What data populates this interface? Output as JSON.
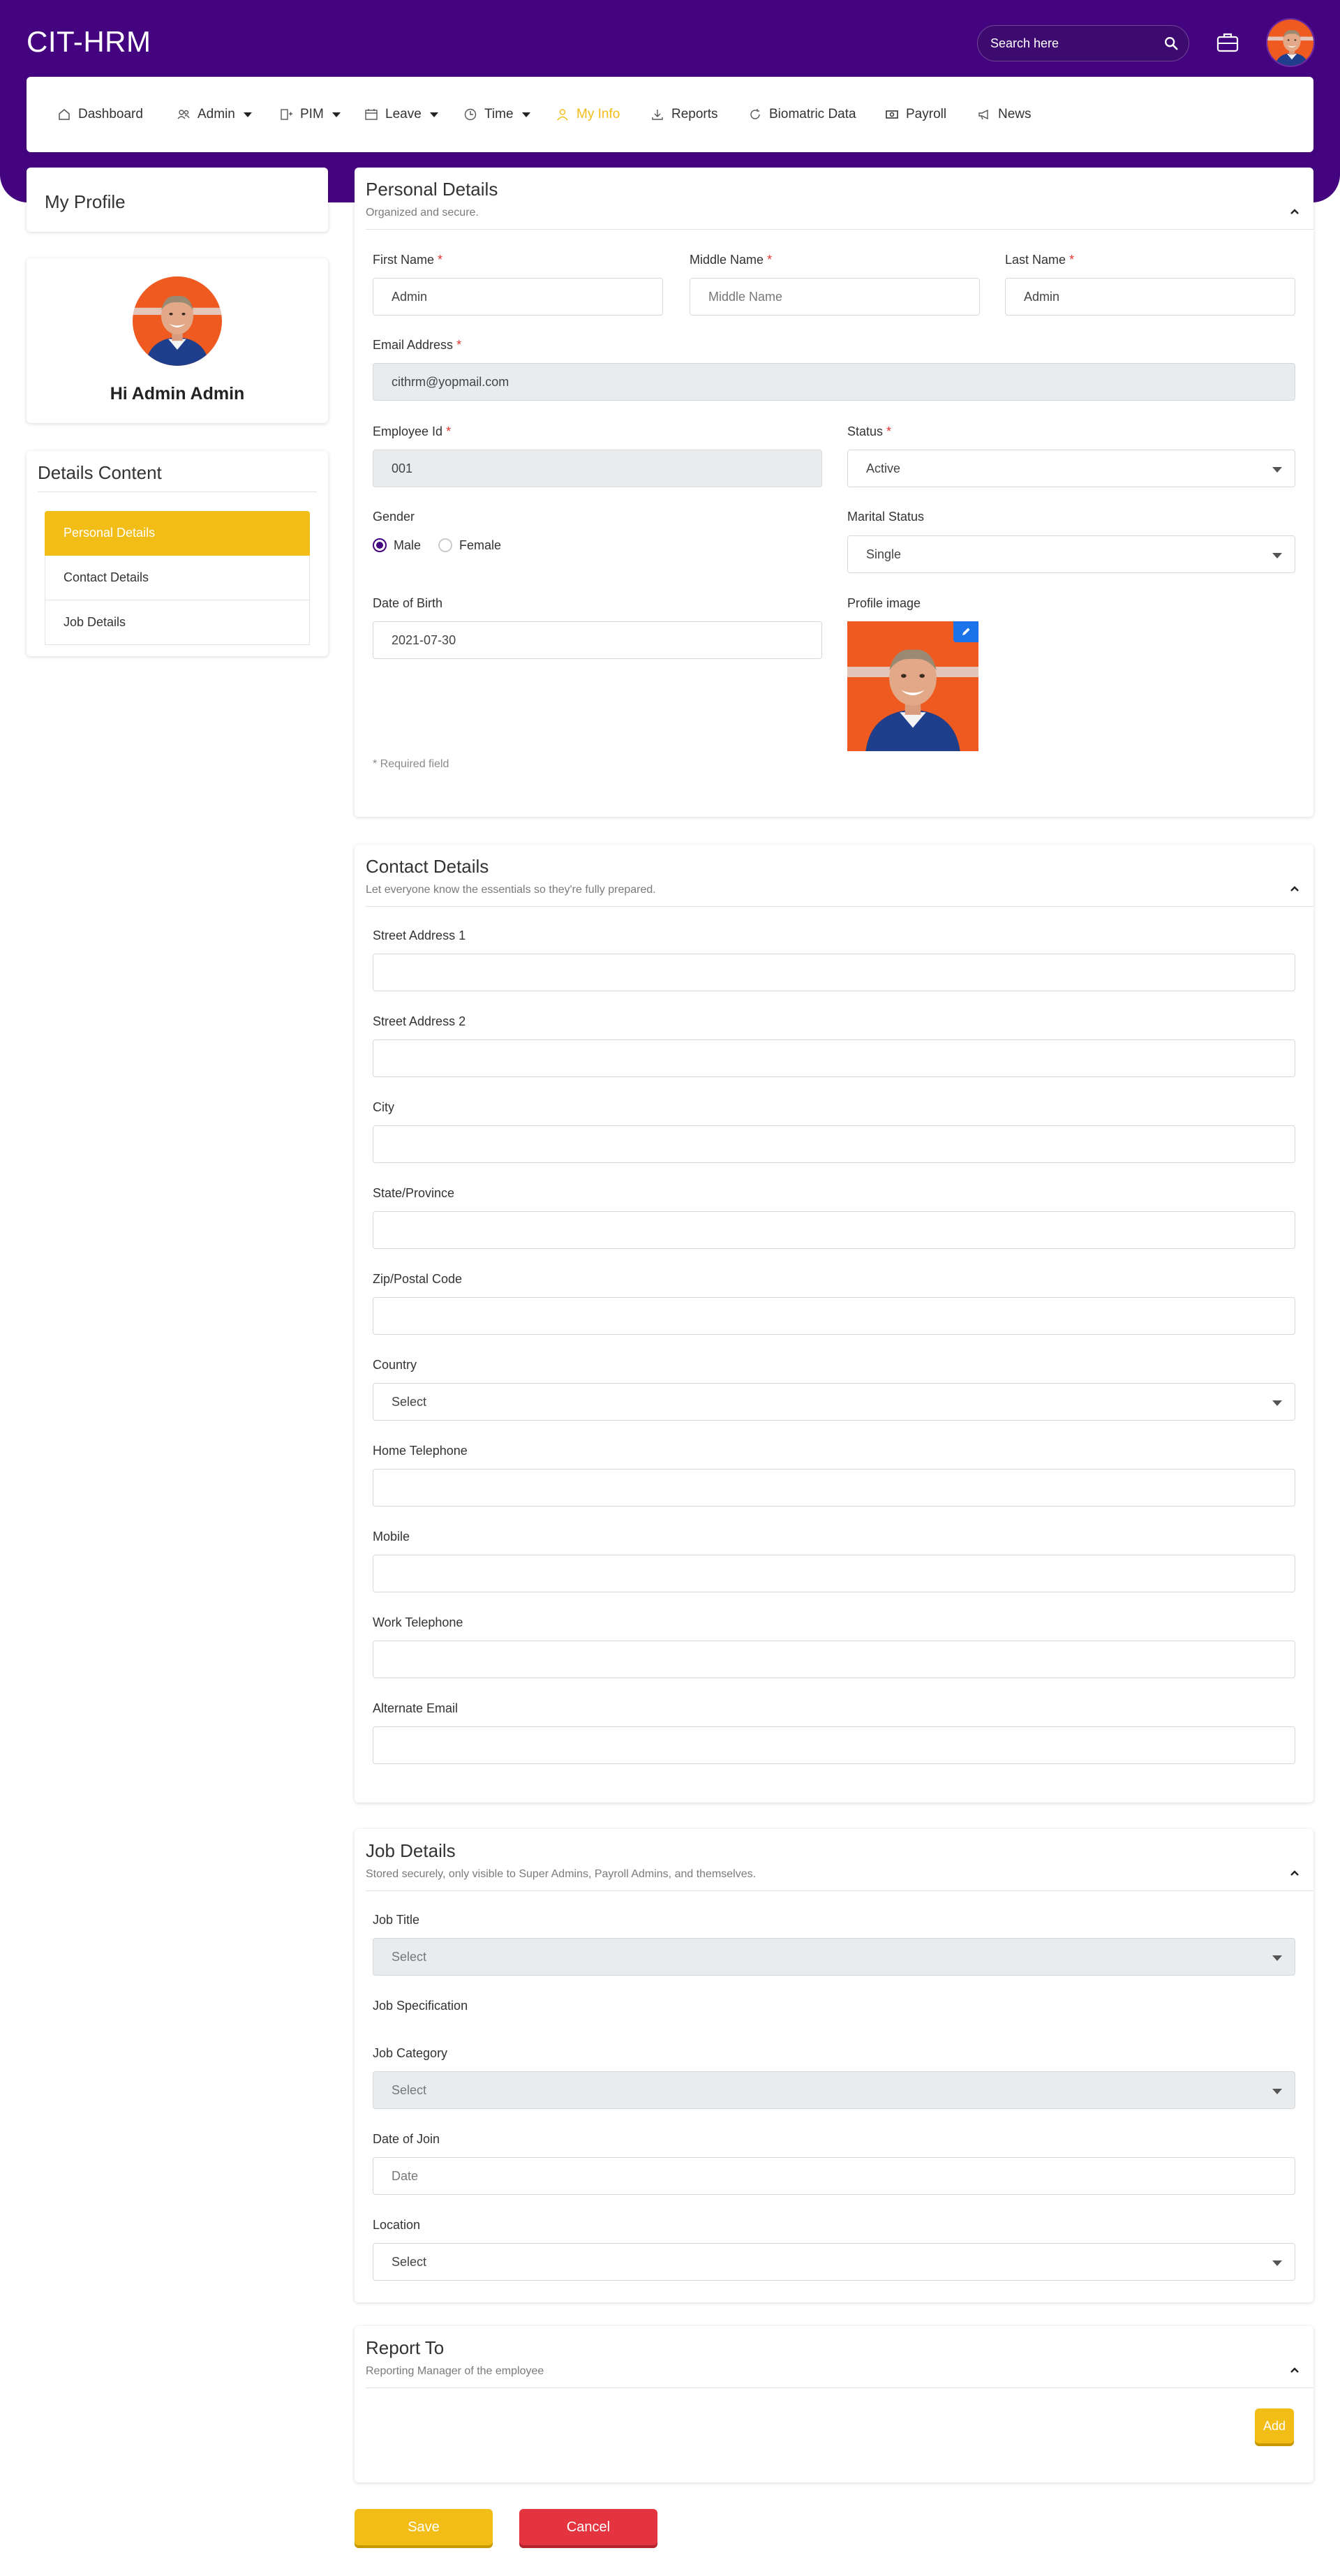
{
  "app": {
    "title": "CIT-HRM"
  },
  "search": {
    "placeholder": "Search here"
  },
  "icons": {
    "search": "search-icon",
    "briefcase": "briefcase-icon",
    "avatar": "user-avatar"
  },
  "colors": {
    "brand": "#44047f",
    "accent": "#f2bd16",
    "danger": "#e3343f",
    "link": "#1a73e8"
  },
  "nav": {
    "items": [
      {
        "label": "Dashboard",
        "icon": "home-icon",
        "active": false,
        "dropdown": false
      },
      {
        "label": "Admin",
        "icon": "users-icon",
        "active": false,
        "dropdown": true
      },
      {
        "label": "PIM",
        "icon": "user-plus-icon",
        "active": false,
        "dropdown": true
      },
      {
        "label": "Leave",
        "icon": "calendar-icon",
        "active": false,
        "dropdown": true
      },
      {
        "label": "Time",
        "icon": "clock-icon",
        "active": false,
        "dropdown": true
      },
      {
        "label": "My Info",
        "icon": "user-icon",
        "active": true,
        "dropdown": false
      },
      {
        "label": "Reports",
        "icon": "download-icon",
        "active": false,
        "dropdown": false
      },
      {
        "label": "Biomatric Data",
        "icon": "refresh-icon",
        "active": false,
        "dropdown": false
      },
      {
        "label": "Payroll",
        "icon": "money-icon",
        "active": false,
        "dropdown": false
      },
      {
        "label": "News",
        "icon": "megaphone-icon",
        "active": false,
        "dropdown": false
      }
    ]
  },
  "sidebar": {
    "profile_title": "My Profile",
    "greeting": "Hi Admin Admin",
    "details_title": "Details Content",
    "items": [
      {
        "label": "Personal Details",
        "active": true
      },
      {
        "label": "Contact Details",
        "active": false
      },
      {
        "label": "Job Details",
        "active": false
      }
    ]
  },
  "personal": {
    "title": "Personal Details",
    "subtitle": "Organized and secure.",
    "first_name_label": "First Name",
    "first_name_value": "Admin",
    "middle_name_label": "Middle Name",
    "middle_name_placeholder": "Middle Name",
    "last_name_label": "Last Name",
    "last_name_value": "Admin",
    "email_label": "Email Address",
    "email_value": "cithrm@yopmail.com",
    "employee_id_label": "Employee Id",
    "employee_id_value": "001",
    "status_label": "Status",
    "status_value": "Active",
    "gender_label": "Gender",
    "gender_male": "Male",
    "gender_female": "Female",
    "gender_selected": "Male",
    "marital_label": "Marital Status",
    "marital_value": "Single",
    "dob_label": "Date of Birth",
    "dob_value": "2021-07-30",
    "profile_image_label": "Profile image",
    "required_note": "* Required field",
    "required_marker": "*"
  },
  "contact": {
    "title": "Contact Details",
    "subtitle": "Let everyone know the essentials so they're fully prepared.",
    "street1_label": "Street Address 1",
    "street2_label": "Street Address 2",
    "city_label": "City",
    "state_label": "State/Province",
    "zip_label": "Zip/Postal Code",
    "country_label": "Country",
    "country_value": "Select",
    "home_phone_label": "Home Telephone",
    "mobile_label": "Mobile",
    "work_phone_label": "Work Telephone",
    "alt_email_label": "Alternate Email"
  },
  "job": {
    "title": "Job Details",
    "subtitle": "Stored securely, only visible to Super Admins, Payroll Admins, and themselves.",
    "job_title_label": "Job Title",
    "job_title_value": "Select",
    "job_spec_label": "Job Specification",
    "job_category_label": "Job Category",
    "job_category_value": "Select",
    "date_join_label": "Date of Join",
    "date_join_placeholder": "Date",
    "location_label": "Location",
    "location_value": "Select"
  },
  "report": {
    "title": "Report To",
    "subtitle": "Reporting Manager of the employee",
    "add_label": "Add"
  },
  "actions": {
    "save_label": "Save",
    "cancel_label": "Cancel"
  }
}
